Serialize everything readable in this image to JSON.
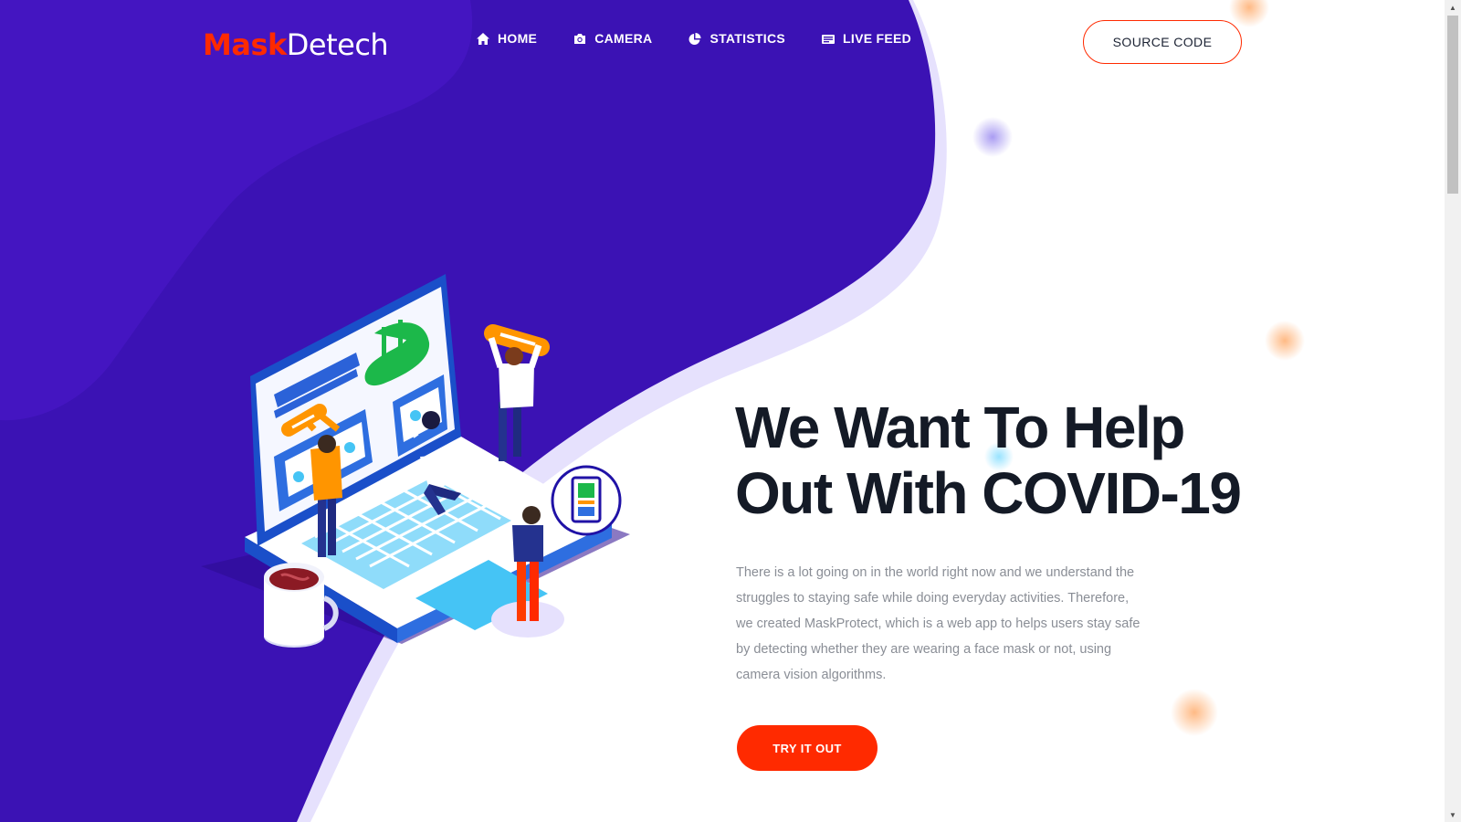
{
  "brand": {
    "part1": "Mask",
    "part2": "Detech"
  },
  "nav": {
    "items": [
      {
        "label": "HOME",
        "icon": "home-icon"
      },
      {
        "label": "CAMERA",
        "icon": "camera-icon"
      },
      {
        "label": "STATISTICS",
        "icon": "pie-chart-icon"
      },
      {
        "label": "LIVE FEED",
        "icon": "feed-icon"
      }
    ],
    "source_button": "SOURCE CODE"
  },
  "hero": {
    "title_line1": "We Want To Help",
    "title_line2": "Out With COVID-19",
    "paragraph": "There is a lot going on in the world right now and we understand the struggles to staying safe while doing everyday activities. Therefore, we created MaskProtect, which is a web app to helps users stay safe by detecting whether they are wearing a face mask or not, using camera vision algorithms.",
    "cta_button": "TRY IT OUT"
  },
  "colors": {
    "primary_purple": "#3b12b4",
    "accent_red": "#ff2a00",
    "heading_dark": "#141a26",
    "body_text": "#8a8e96",
    "money_green": "#1cb84a",
    "screen_blue": "#45c4f5"
  }
}
